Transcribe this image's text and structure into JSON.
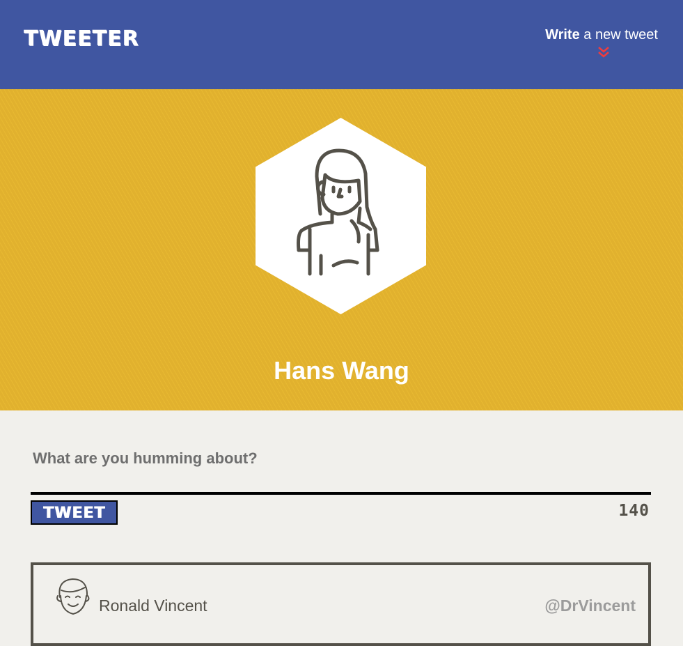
{
  "nav": {
    "brand": "TWEETER",
    "compose_toggle": {
      "strong": "Write",
      "rest": " a new tweet"
    },
    "chevron_icon": "double-chevron-down-icon",
    "background_color": "#4056a1"
  },
  "profile": {
    "name": "Hans Wang",
    "avatar_icon": "user-avatar-icon",
    "background_color": "#e1b12e"
  },
  "compose": {
    "prompt": "What are you humming about?",
    "input_value": "",
    "button_label": "TWEET",
    "char_counter": "140"
  },
  "tweets": [
    {
      "author_name": "Ronald Vincent",
      "handle": "@DrVincent",
      "avatar_icon": "user-avatar-icon"
    }
  ],
  "colors": {
    "accent_blue": "#4056a1",
    "gold": "#e1b12e",
    "chevron_red": "#f13c3c",
    "dark_text": "#545149",
    "page_bg": "#f1f0ec"
  }
}
